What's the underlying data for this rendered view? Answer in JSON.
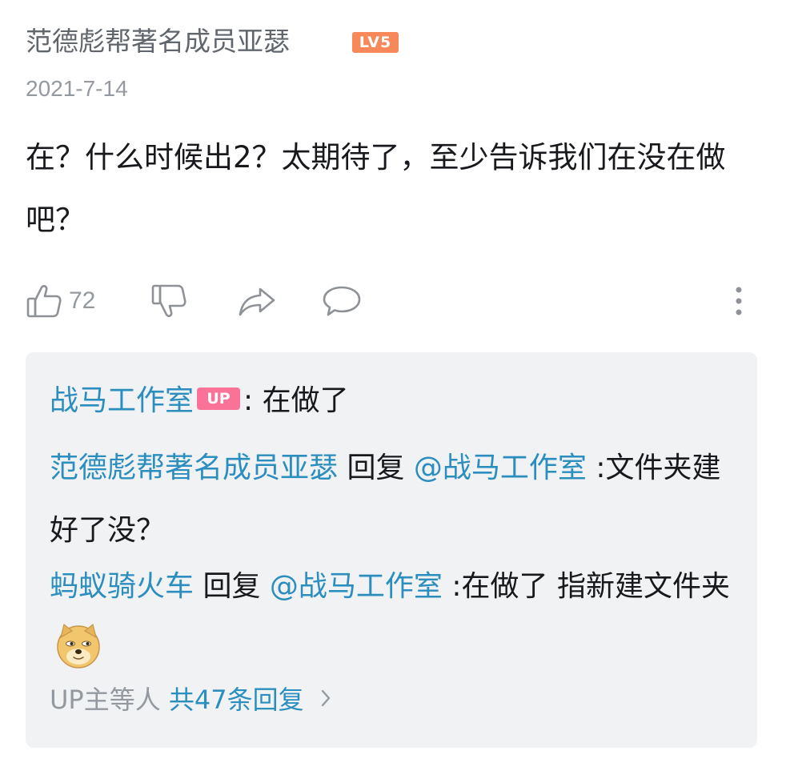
{
  "comment": {
    "username": "范德彪帮著名成员亚瑟",
    "level_badge": "LV5",
    "date": "2021-7-14",
    "text": "在？什么时候出2？太期待了，至少告诉我们在没在做吧？",
    "like_count": "72"
  },
  "actions": {
    "icons": [
      "thumbs-up-icon",
      "thumbs-down-icon",
      "share-icon",
      "comment-bubble-icon",
      "more-vertical-icon"
    ]
  },
  "replies": [
    {
      "author": "战马工作室",
      "badge": "UP",
      "separator": ": ",
      "text": "在做了"
    },
    {
      "author": "范德彪帮著名成员亚瑟",
      "reply_word": " 回复 ",
      "mention": "@战马工作室",
      "text": " :文件夹建好了没？"
    },
    {
      "author": "蚂蚁骑火车",
      "reply_word": " 回复 ",
      "mention": "@战马工作室",
      "text": " :在做了 指新建文件夹",
      "emoji": "doge-emoji"
    }
  ],
  "summary": {
    "who": "UP主等人",
    "count_text": "共47条回复"
  },
  "colors": {
    "link_blue": "#2b8ebf",
    "level_badge": "#f6885a",
    "up_badge": "#fb7299",
    "panel_bg": "#f1f2f3",
    "muted": "#9499a0"
  }
}
